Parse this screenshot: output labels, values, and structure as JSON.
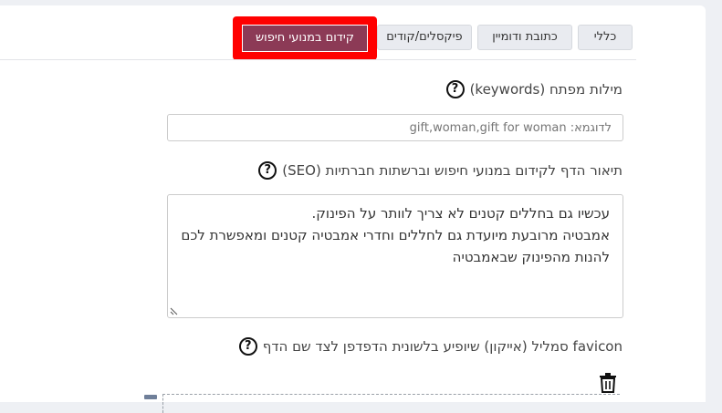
{
  "tabs": [
    {
      "label": "כללי"
    },
    {
      "label": "כתובת ודומיין"
    },
    {
      "label": "פיקסלים/קודים"
    },
    {
      "label": "קידום במנועי חיפוש"
    }
  ],
  "keywords": {
    "label": "מילות מפתח (keywords)",
    "placeholder": "לדוגמא: gift,woman,gift for woman"
  },
  "seo": {
    "label": "תיאור הדף לקידום במנועי חיפוש וברשתות חברתיות (SEO)",
    "lines": [
      "עכשיו גם בחללים קטנים לא צריך לוותר על הפינוק.",
      "אמבטיה מרובעת מיועדת גם לחללים וחדרי אמבטיה קטנים ומאפשרת לכם",
      "להנות מהפינוק שבאמבטיה"
    ]
  },
  "favicon": {
    "label": "favicon סמליל (אייקון) שיופיע בלשונית הדפדפן לצד שם הדף"
  },
  "icons": {
    "help": "question-circle-icon",
    "trash": "trash-icon"
  },
  "colors": {
    "active_tab": "#8c3a56",
    "highlight": "#ff0000"
  }
}
